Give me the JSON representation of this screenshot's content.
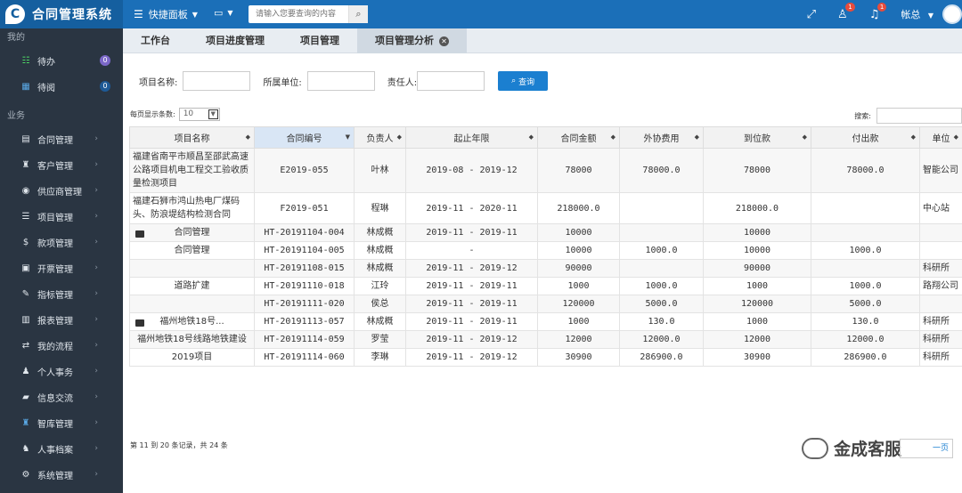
{
  "app": {
    "title": "合同管理系统"
  },
  "topbar": {
    "menu_label": "快捷面板",
    "search_placeholder": "请输入您要查询的内容",
    "badge_user": "1",
    "badge_bell": "1",
    "user_name": "帐总"
  },
  "sidebar": {
    "section_mine": "我的",
    "mine_items": [
      {
        "label": "待办",
        "badge": "0"
      },
      {
        "label": "待阅",
        "badge": "0"
      }
    ],
    "section_business": "业务",
    "business_items": [
      {
        "label": "合同管理"
      },
      {
        "label": "客户管理"
      },
      {
        "label": "供应商管理"
      },
      {
        "label": "项目管理"
      },
      {
        "label": "款项管理"
      },
      {
        "label": "开票管理"
      },
      {
        "label": "指标管理"
      },
      {
        "label": "报表管理"
      },
      {
        "label": "我的流程"
      },
      {
        "label": "个人事务"
      },
      {
        "label": "信息交流"
      },
      {
        "label": "智库管理"
      },
      {
        "label": "人事档案"
      },
      {
        "label": "系统管理"
      }
    ]
  },
  "tabs": [
    {
      "label": "工作台"
    },
    {
      "label": "项目进度管理"
    },
    {
      "label": "项目管理"
    },
    {
      "label": "项目管理分析"
    }
  ],
  "filter": {
    "project_name_label": "项目名称:",
    "unit_label": "所属单位:",
    "owner_label": "责任人:",
    "query_label": "查询"
  },
  "table_controls": {
    "page_size_label": "每页显示条数:",
    "page_size_value": "10",
    "search_label": "搜索:"
  },
  "table": {
    "columns": [
      "项目名称",
      "合同编号",
      "负责人",
      "起止年限",
      "合同金额",
      "外协费用",
      "到位款",
      "付出款",
      "单位"
    ],
    "rows": [
      {
        "name": "福建省南平市顺昌至邵武高速公路项目机电工程交工验收质量检测项目",
        "code": "E2019-055",
        "owner": "叶林",
        "period": "2019-08 - 2019-12",
        "amount": "78000",
        "outsource": "78000.0",
        "received": "78000",
        "paid": "78000.0",
        "unit": "智能公司"
      },
      {
        "name": "福建石狮市鸿山热电厂煤码头、防浪堤结构检测合同",
        "code": "F2019-051",
        "owner": "程琳",
        "period": "2019-11 - 2020-11",
        "amount": "218000.0",
        "outsource": "",
        "received": "218000.0",
        "paid": "",
        "unit": "中心站"
      },
      {
        "name": "合同管理",
        "folder": true,
        "code": "HT-20191104-004",
        "owner": "林成概",
        "period": "2019-11 - 2019-11",
        "amount": "10000",
        "outsource": "",
        "received": "10000",
        "paid": "",
        "unit": ""
      },
      {
        "name": "合同管理",
        "code": "HT-20191104-005",
        "owner": "林成概",
        "period": "-",
        "amount": "10000",
        "outsource": "1000.0",
        "received": "10000",
        "paid": "1000.0",
        "unit": ""
      },
      {
        "name": "",
        "code": "HT-20191108-015",
        "owner": "林成概",
        "period": "2019-11 - 2019-12",
        "amount": "90000",
        "outsource": "",
        "received": "90000",
        "paid": "",
        "unit": "科研所"
      },
      {
        "name": "道路扩建",
        "code": "HT-20191110-018",
        "owner": "江玲",
        "period": "2019-11 - 2019-11",
        "amount": "1000",
        "outsource": "1000.0",
        "received": "1000",
        "paid": "1000.0",
        "unit": "路翔公司"
      },
      {
        "name": "",
        "code": "HT-20191111-020",
        "owner": "侯总",
        "period": "2019-11 - 2019-11",
        "amount": "120000",
        "outsource": "5000.0",
        "received": "120000",
        "paid": "5000.0",
        "unit": ""
      },
      {
        "name": "福州地铁18号...",
        "folder": true,
        "code": "HT-20191113-057",
        "owner": "林成概",
        "period": "2019-11 - 2019-11",
        "amount": "1000",
        "outsource": "130.0",
        "received": "1000",
        "paid": "130.0",
        "unit": "科研所"
      },
      {
        "name": "福州地铁18号线路地铁建设",
        "code": "HT-20191114-059",
        "owner": "罗莹",
        "period": "2019-11 - 2019-12",
        "amount": "12000",
        "outsource": "12000.0",
        "received": "12000",
        "paid": "12000.0",
        "unit": "科研所"
      },
      {
        "name": "2019项目",
        "code": "HT-20191114-060",
        "owner": "李琳",
        "period": "2019-11 - 2019-12",
        "amount": "30900",
        "outsource": "286900.0",
        "received": "30900",
        "paid": "286900.0",
        "unit": "科研所"
      }
    ]
  },
  "footer": {
    "records_info": "第 11 到 20 条记录，共 24 条",
    "pager_label": "一页"
  },
  "watermark": {
    "text": "金成客服"
  }
}
